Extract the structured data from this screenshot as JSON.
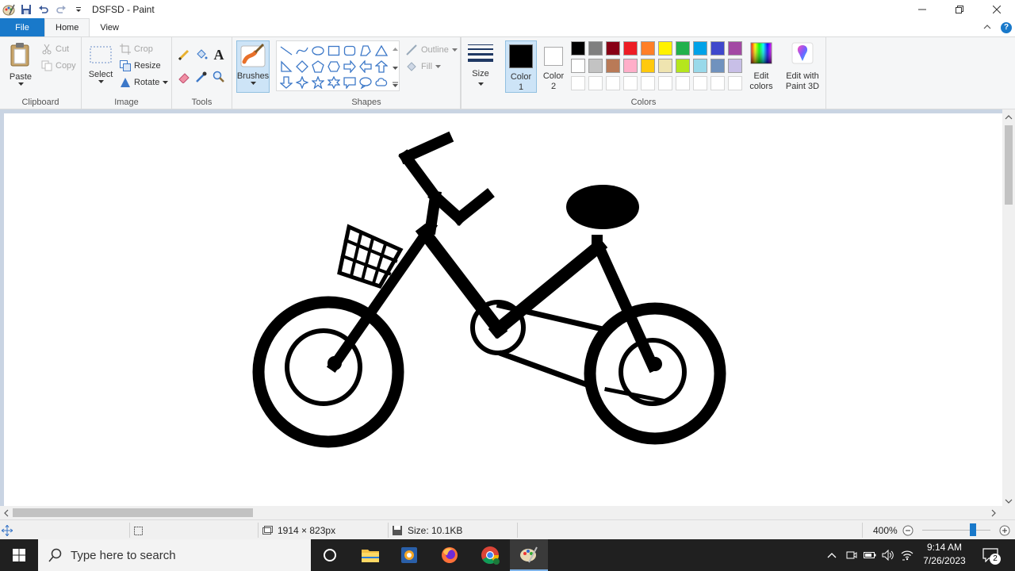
{
  "window": {
    "title": "DSFSD - Paint",
    "quick_access": [
      "paint-app-icon",
      "save-icon",
      "undo-icon",
      "redo-icon",
      "customize-dropdown-icon"
    ]
  },
  "tabs": {
    "file": "File",
    "home": "Home",
    "view": "View"
  },
  "ribbon": {
    "clipboard": {
      "label": "Clipboard",
      "paste": "Paste",
      "cut": "Cut",
      "copy": "Copy"
    },
    "image": {
      "label": "Image",
      "select": "Select",
      "crop": "Crop",
      "resize": "Resize",
      "rotate": "Rotate"
    },
    "tools": {
      "label": "Tools"
    },
    "brushes": {
      "label": "Brushes"
    },
    "shapes": {
      "label": "Shapes",
      "outline": "Outline",
      "fill": "Fill"
    },
    "size": {
      "label": "Size"
    },
    "colors": {
      "label": "Colors",
      "color1": {
        "line1": "Color",
        "line2": "1",
        "value": "#000000"
      },
      "color2": {
        "line1": "Color",
        "line2": "2",
        "value": "#ffffff"
      },
      "edit_colors": {
        "line1": "Edit",
        "line2": "colors"
      },
      "edit_paint3d": {
        "line1": "Edit with",
        "line2": "Paint 3D"
      },
      "palette_row1": [
        "#000000",
        "#7f7f7f",
        "#880015",
        "#ed1c24",
        "#ff7f27",
        "#fff200",
        "#22b14c",
        "#00a2e8",
        "#3f48cc",
        "#a349a4"
      ],
      "palette_row2": [
        "#ffffff",
        "#c3c3c3",
        "#b97a57",
        "#ffaec9",
        "#ffc90e",
        "#efe4b0",
        "#b5e61d",
        "#99d9ea",
        "#7092be",
        "#c8bfe7"
      ]
    }
  },
  "canvas": {
    "drawing": "bicycle-with-basket"
  },
  "status": {
    "dimensions": "1914 × 823px",
    "size": "Size: 10.1KB",
    "zoom": "400%",
    "zoom_level": 0.74
  },
  "taskbar": {
    "search_placeholder": "Type here to search",
    "time": "9:14 AM",
    "date": "7/26/2023",
    "notification_count": "2"
  }
}
